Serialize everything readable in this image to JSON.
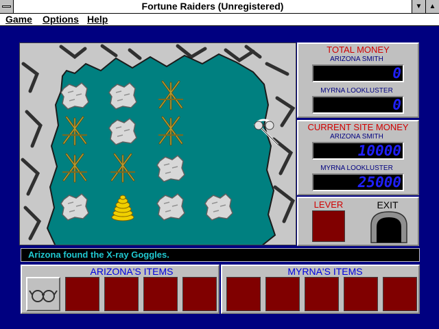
{
  "window": {
    "title": "Fortune Raiders (Unregistered)"
  },
  "menu": [
    "Game",
    "Options",
    "Help"
  ],
  "colors": {
    "cave_floor": "#008080",
    "lcd_digits": "#2020ff",
    "panel_title": "#d00000",
    "status_text": "#20c8d0"
  },
  "board": {
    "rows": [
      [
        "rock",
        "rock",
        "sticks",
        null,
        null
      ],
      [
        "sticks",
        "rock",
        "sticks",
        null,
        "pickaxe-goggles"
      ],
      [
        "sticks",
        "sticks",
        "rock",
        null,
        null
      ],
      [
        "rock",
        "gold",
        "rock",
        "rock",
        null
      ]
    ]
  },
  "total_money": {
    "title": "TOTAL MONEY",
    "players": [
      {
        "name": "ARIZONA SMITH",
        "value": "0"
      },
      {
        "name": "MYRNA LOOKLUSTER",
        "value": "0"
      }
    ]
  },
  "site_money": {
    "title": "CURRENT SITE MONEY",
    "players": [
      {
        "name": "ARIZONA SMITH",
        "value": "10000"
      },
      {
        "name": "MYRNA LOOKLUSTER",
        "value": "25000"
      }
    ]
  },
  "controls": {
    "lever_label": "LEVER",
    "exit_label": "EXIT"
  },
  "status": "Arizona found the X-ray Goggles.",
  "arizona_items": {
    "title": "ARIZONA'S ITEMS",
    "slots": [
      "xray-goggles",
      null,
      null,
      null,
      null
    ]
  },
  "myrna_items": {
    "title": "MYRNA'S ITEMS",
    "slots": [
      null,
      null,
      null,
      null,
      null
    ]
  }
}
